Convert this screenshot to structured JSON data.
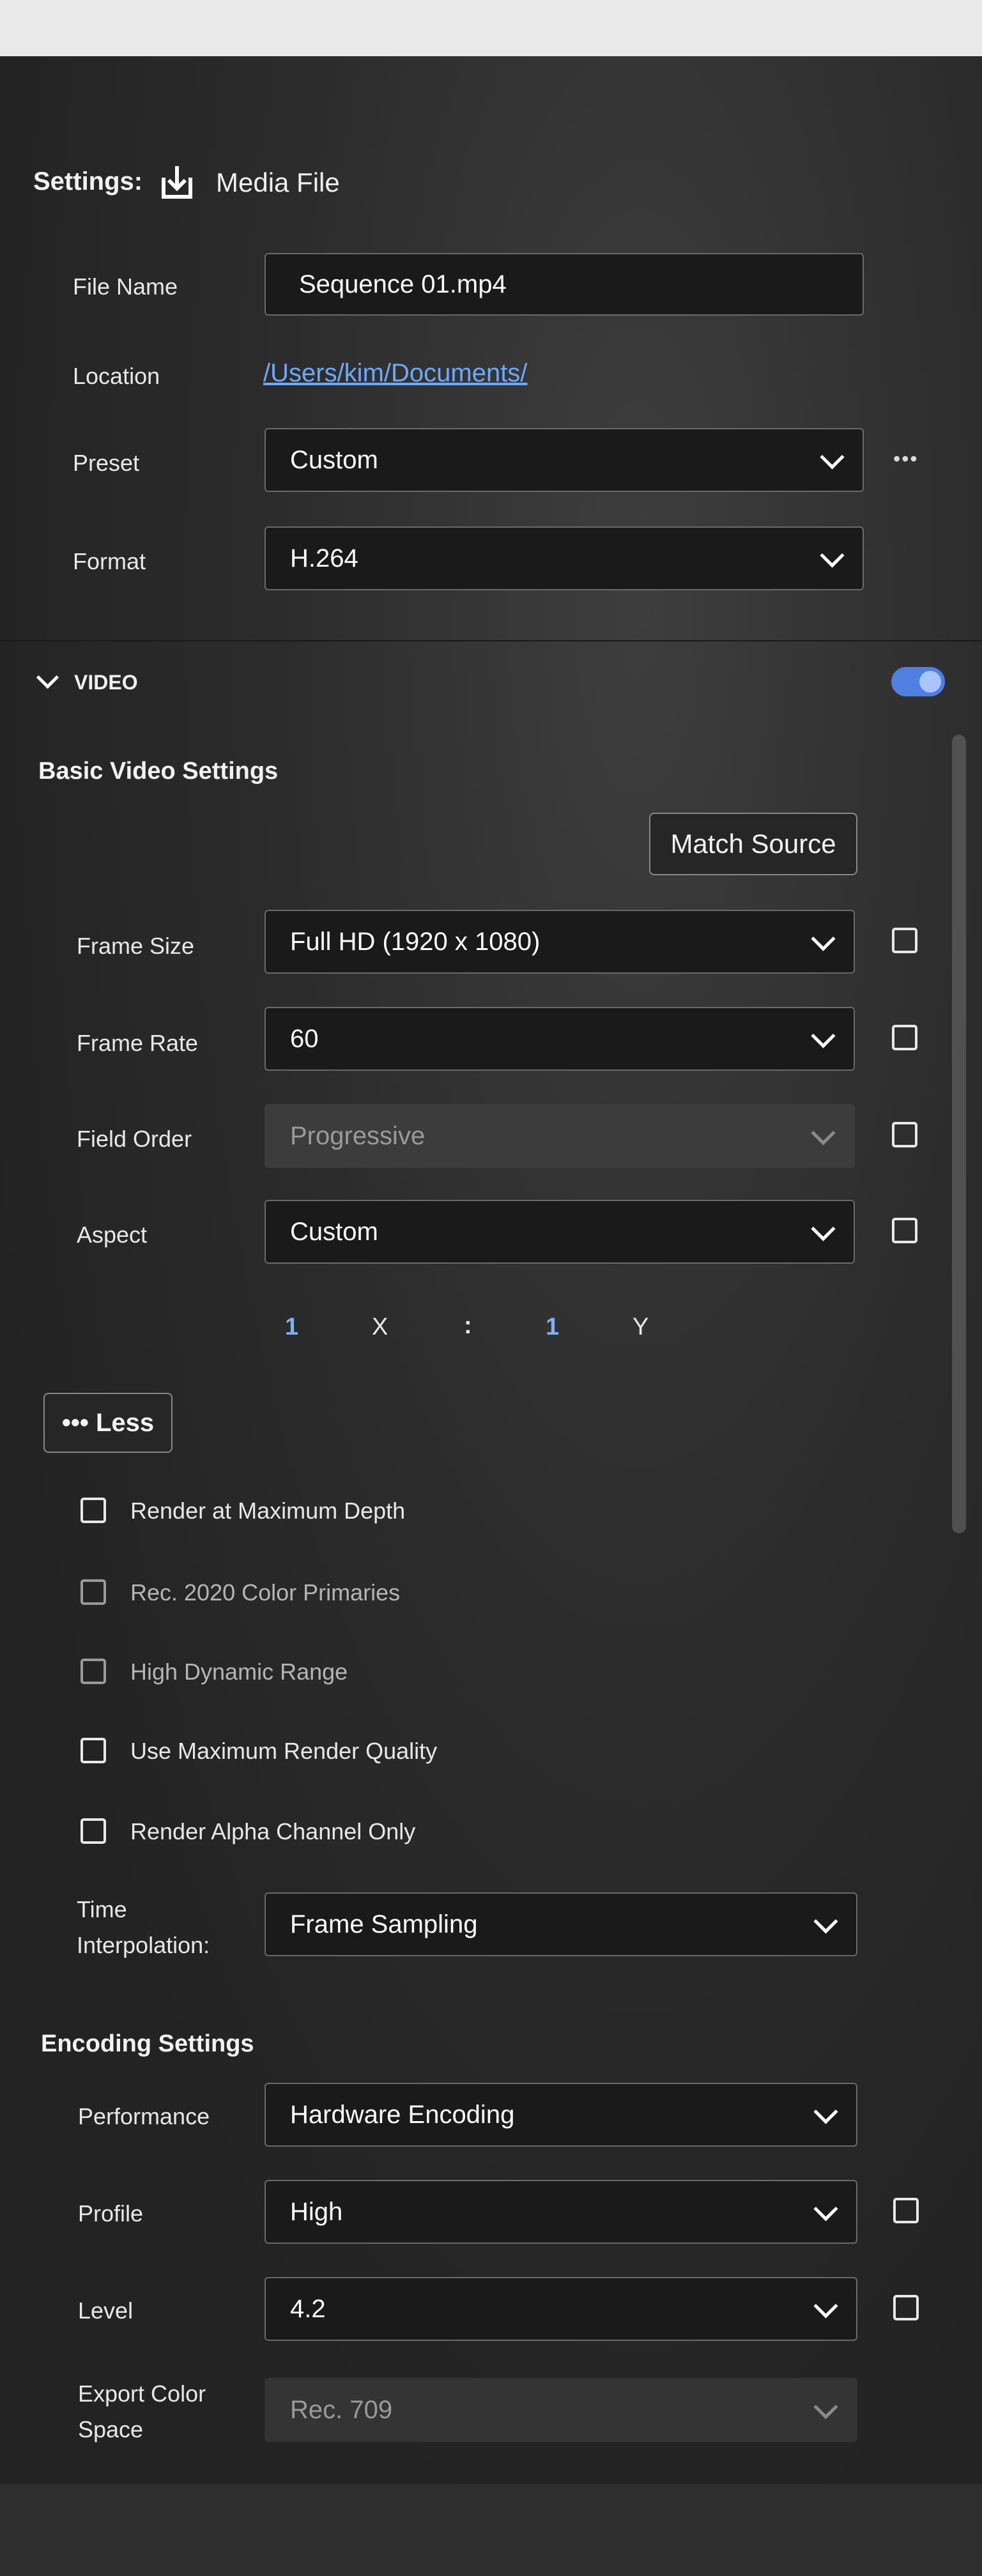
{
  "header": {
    "settings_label": "Settings:",
    "media_label": "Media File"
  },
  "file_name": {
    "label": "File Name",
    "value": "Sequence 01.mp4"
  },
  "location": {
    "label": "Location",
    "value": "/Users/kim/Documents/"
  },
  "preset": {
    "label": "Preset",
    "value": "Custom",
    "more": "•••"
  },
  "format": {
    "label": "Format",
    "value": "H.264"
  },
  "video_section": {
    "label": "VIDEO",
    "toggle_on": true
  },
  "basic_video": {
    "title": "Basic Video Settings",
    "match_source": "Match Source",
    "frame_size": {
      "label": "Frame Size",
      "value": "Full HD (1920 x 1080)"
    },
    "frame_rate": {
      "label": "Frame Rate",
      "value": "60"
    },
    "field_order": {
      "label": "Field Order",
      "value": "Progressive"
    },
    "aspect": {
      "label": "Aspect",
      "value": "Custom"
    },
    "aspect_ratio": {
      "x_value": "1",
      "x_label": "X",
      "sep": ":",
      "y_value": "1",
      "y_label": "Y"
    },
    "less_button": "••• Less"
  },
  "checkboxes": [
    {
      "label": "Render at Maximum Depth"
    },
    {
      "label": "Rec. 2020 Color Primaries"
    },
    {
      "label": "High Dynamic Range"
    },
    {
      "label": "Use Maximum Render Quality"
    },
    {
      "label": "Render Alpha Channel Only"
    }
  ],
  "time_interp": {
    "label_line1": "Time",
    "label_line2": "Interpolation:",
    "value": "Frame Sampling"
  },
  "encoding": {
    "title": "Encoding Settings",
    "performance": {
      "label": "Performance",
      "value": "Hardware Encoding"
    },
    "profile": {
      "label": "Profile",
      "value": "High"
    },
    "level": {
      "label": "Level",
      "value": "4.2"
    },
    "color_space": {
      "label_line1": "Export Color",
      "label_line2": "Space",
      "value": "Rec. 709"
    }
  },
  "colors": {
    "link": "#6ea8ff",
    "toggle": "#4f7fe0",
    "accent_number": "#7fb0ff"
  }
}
